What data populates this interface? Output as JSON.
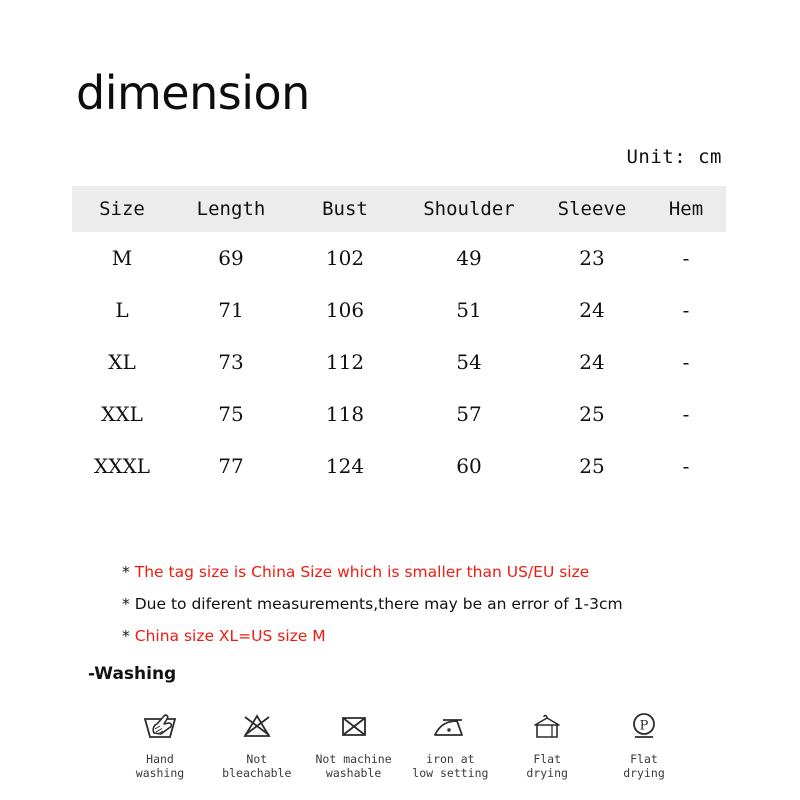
{
  "page_title": "dimension",
  "unit_label": "Unit: cm",
  "table": {
    "columns": [
      "Size",
      "Length",
      "Bust",
      "Shoulder",
      "Sleeve",
      "Hem"
    ],
    "rows": [
      [
        "M",
        "69",
        "102",
        "49",
        "23",
        "-"
      ],
      [
        "L",
        "71",
        "106",
        "51",
        "24",
        "-"
      ],
      [
        "XL",
        "73",
        "112",
        "54",
        "24",
        "-"
      ],
      [
        "XXL",
        "75",
        "118",
        "57",
        "25",
        "-"
      ],
      [
        "XXXL",
        "77",
        "124",
        "60",
        "25",
        "-"
      ]
    ],
    "header_background": "#ececec"
  },
  "notices": [
    {
      "star": "*",
      "text": "The tag size is China Size which is smaller than US/EU size",
      "color": "#ee1c10"
    },
    {
      "star": "*",
      "text": "Due to diferent measurements,there may be an error of 1-3cm",
      "color": "#111111"
    },
    {
      "star": "*",
      "text": "China size XL=US size M",
      "color": "#ee1c10"
    }
  ],
  "washing_heading": "-Washing",
  "care_icons": [
    {
      "icon": "hand-wash-icon",
      "label": "Hand\nwashing"
    },
    {
      "icon": "no-bleach-icon",
      "label": "Not\nbleachable"
    },
    {
      "icon": "no-machine-wash-icon",
      "label": "Not machine\nwashable"
    },
    {
      "icon": "iron-low-heat-icon",
      "label": "iron at\nlow setting"
    },
    {
      "icon": "hanger-dry-icon",
      "label": "Flat\ndrying"
    },
    {
      "icon": "dry-clean-p-icon",
      "label": "Flat\ndrying"
    }
  ]
}
